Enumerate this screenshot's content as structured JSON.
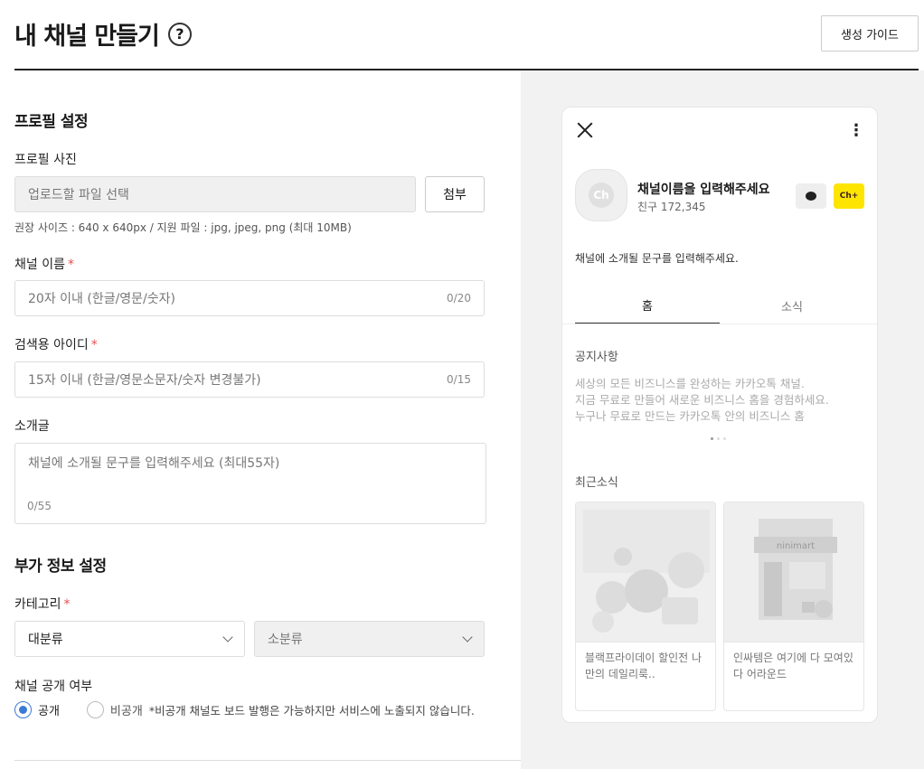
{
  "header": {
    "title": "내 채널 만들기",
    "help_glyph": "?",
    "guide_button": "생성 가이드"
  },
  "profile": {
    "section_title": "프로필 설정",
    "photo_label": "프로필 사진",
    "photo_placeholder": "업로드할 파일 선택",
    "attach_button": "첨부",
    "photo_hint": "권장 사이즈 : 640 x 640px / 지원 파일 : jpg, jpeg, png (최대 10MB)",
    "name_label": "채널 이름",
    "name_placeholder": "20자 이내 (한글/영문/숫자)",
    "name_counter": "0/20",
    "id_label": "검색용 아이디",
    "id_placeholder": "15자 이내 (한글/영문소문자/숫자 변경불가)",
    "id_counter": "0/15",
    "intro_label": "소개글",
    "intro_placeholder": "채널에 소개될 문구를 입력해주세요 (최대55자)",
    "intro_counter": "0/55",
    "required_mark": "*"
  },
  "extra": {
    "section_title": "부가 정보 설정",
    "category_label": "카테고리",
    "category_main": "대분류",
    "category_sub": "소분류",
    "visibility_label": "채널 공개 여부",
    "public_label": "공개",
    "private_label": "비공개",
    "private_note": "*비공개 채널도 보드 발행은 가능하지만 서비스에 노출되지 않습니다."
  },
  "preview": {
    "more_glyph": "⋮",
    "avatar_text": "Ch",
    "channel_name": "채널이름을 입력해주세요",
    "friends": "친구 172,345",
    "add_text": "Ch+",
    "description": "채널에 소개될 문구를 입력해주세요.",
    "tabs": [
      "홈",
      "소식"
    ],
    "notice_title": "공지사항",
    "notice_lines": [
      "세상의 모든 비즈니스를 완성하는 카카오톡 채널.",
      "지금 무료로 만들어 새로운 비즈니스 홈을 경험하세요.",
      "누구나 무료로 만드는 카카오톡 안의 비즈니스 홈"
    ],
    "recent_title": "최근소식",
    "news": [
      {
        "text": "블랙프라이데이 할인전 나만의 데일리룩.."
      },
      {
        "text": "인싸템은 여기에 다 모여있다 어라운드",
        "sign": "ninimart"
      }
    ]
  },
  "colors": {
    "accent": "#3a7bd5",
    "required": "#e65050",
    "kakao_yellow": "#fee500"
  }
}
